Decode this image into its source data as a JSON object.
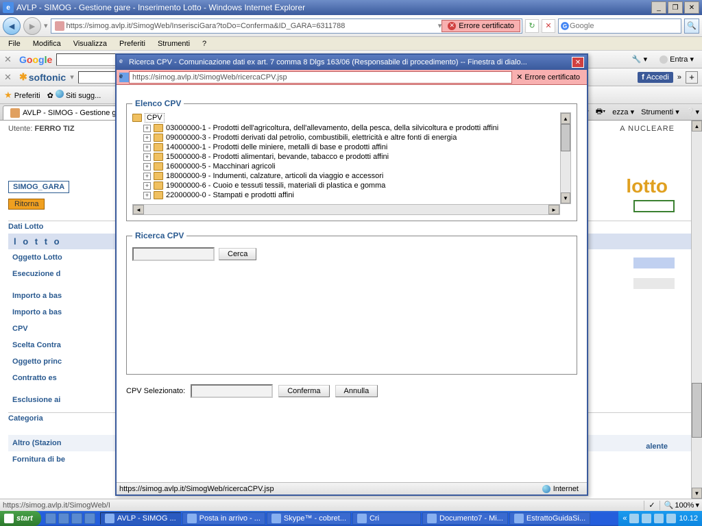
{
  "window": {
    "title": "AVLP - SIMOG - Gestione gare - Inserimento Lotto - Windows Internet Explorer",
    "url": "https://simog.avlp.it/SimogWeb/InserisciGara?toDo=Conferma&ID_GARA=6311788",
    "cert_error": "Errore certificato",
    "search_placeholder": "Google"
  },
  "menu": {
    "items": [
      "File",
      "Modifica",
      "Visualizza",
      "Preferiti",
      "Strumenti",
      "?"
    ]
  },
  "toolbars": {
    "google_entra": "Entra ▾",
    "fb_accedi": "Accedi",
    "more": "»"
  },
  "favbar": {
    "preferiti": "Preferiti",
    "siti_sugg": "Siti sugg..."
  },
  "tabs": {
    "active": "AVLP - SIMOG - Gestione ga...",
    "right": {
      "ezza": "ezza ▾",
      "strumenti": "Strumenti ▾",
      "help": "❔▾"
    }
  },
  "page": {
    "utente_label": "Utente:",
    "utente_value": "FERRO TIZ",
    "nuclear": "A NUCLEARE",
    "lotto_big": "lotto",
    "simog_gara": "SIMOG_GARA",
    "ritorna": "Ritorna",
    "dati_lotto": "Dati Lotto",
    "lotto_row": "l o t t o",
    "fields": [
      "Oggetto Lotto",
      "Esecuzione d",
      "Importo a bas",
      "Importo a bas",
      "CPV",
      "Scelta Contra",
      "Oggetto princ",
      "Contratto es",
      "Esclusione ai"
    ],
    "categoria": "Categoria",
    "altro": "Altro (Stazion",
    "fornitura": "Fornitura di be",
    "alente": "alente"
  },
  "modal": {
    "title": "Ricerca CPV - Comunicazione dati ex art. 7 comma 8 Dlgs 163/06 (Responsabile di procedimento) -- Finestra di dialo...",
    "url": "https://simog.avlp.it/SimogWeb/ricercaCPV.jsp",
    "cert_error": "Errore certificato",
    "elenco_legend": "Elenco CPV",
    "tree_root": "CPV",
    "tree_items": [
      "03000000-1 - Prodotti dell'agricoltura, dell'allevamento, della pesca, della silvicoltura e prodotti affini",
      "09000000-3 - Prodotti derivati dal petrolio, combustibili, elettricità e altre fonti di energia",
      "14000000-1 - Prodotti delle miniere, metalli di base e prodotti affini",
      "15000000-8 - Prodotti alimentari, bevande, tabacco e prodotti affini",
      "16000000-5 - Macchinari agricoli",
      "18000000-9 - Indumenti, calzature, articoli da viaggio e accessori",
      "19000000-6 - Cuoio e tessuti tessili, materiali di plastica e gomma",
      "22000000-0 - Stampati e prodotti affini"
    ],
    "ricerca_legend": "Ricerca CPV",
    "cerca_btn": "Cerca",
    "selezionato_label": "CPV Selezionato:",
    "conferma_btn": "Conferma",
    "annulla_btn": "Annulla",
    "status_url": "https://simog.avlp.it/SimogWeb/ricercaCPV.jsp",
    "status_net": "Internet"
  },
  "statusbar": {
    "url": "https://simog.avlp.it/SimogWeb/I",
    "zoom": "100%"
  },
  "taskbar": {
    "start": "start",
    "buttons": [
      "AVLP - SIMOG ...",
      "Posta in arrivo - ...",
      "Skype™ - cobret...",
      "Cri",
      "Documento7 - Mi...",
      "EstrattoGuidaSi..."
    ],
    "tray_expand": "«",
    "clock": "10.12"
  }
}
